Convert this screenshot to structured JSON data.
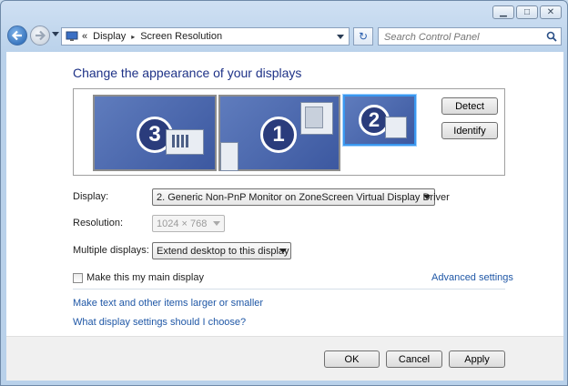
{
  "window": {
    "minimize_glyph": "▁",
    "maximize_glyph": "□",
    "close_glyph": "✕"
  },
  "nav": {
    "breadcrumb_root": "«",
    "breadcrumb": [
      "Display",
      "Screen Resolution"
    ],
    "breadcrumb_separator": "▸",
    "refresh_glyph": "↻",
    "search_placeholder": "Search Control Panel",
    "icons": [
      "back-arrow-icon",
      "forward-arrow-icon",
      "monitor-icon",
      "refresh-icon",
      "search-icon"
    ]
  },
  "main": {
    "title": "Change the appearance of your displays",
    "monitors": [
      {
        "number": "3",
        "selected": false
      },
      {
        "number": "1",
        "selected": false
      },
      {
        "number": "2",
        "selected": true
      }
    ],
    "detect_label": "Detect",
    "identify_label": "Identify",
    "display_label": "Display:",
    "display_value": "2. Generic Non-PnP Monitor on ZoneScreen Virtual Display Driver",
    "resolution_label": "Resolution:",
    "resolution_value": "1024 × 768",
    "multiple_label": "Multiple displays:",
    "multiple_value": "Extend desktop to this display",
    "main_display_label": "Make this my main display",
    "main_display_checked": false,
    "advanced_link": "Advanced settings",
    "link_text_size": "Make text and other items larger or smaller",
    "link_help": "What display settings should I choose?"
  },
  "footer": {
    "ok_label": "OK",
    "cancel_label": "Cancel",
    "apply_label": "Apply"
  },
  "colors": {
    "link": "#1f57a6",
    "title": "#1e3287",
    "monitor_fill": "#4a66ab",
    "selected_border": "#3a98ef"
  }
}
